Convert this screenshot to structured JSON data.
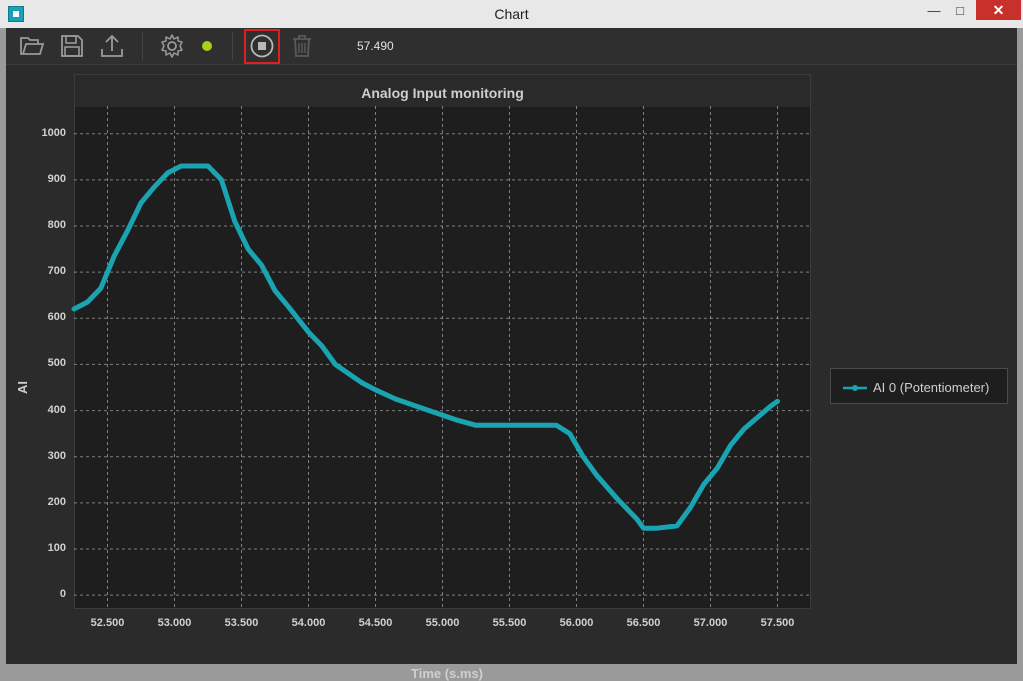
{
  "window": {
    "title": "Chart",
    "minimize_glyph": "—",
    "maximize_glyph": "□",
    "close_glyph": "✕"
  },
  "toolbar": {
    "icons": [
      "folder-open-icon",
      "save-icon",
      "export-icon",
      "gear-icon",
      "status-dot",
      "stop-icon",
      "trash-icon"
    ],
    "time_readout": "57.490",
    "status_color": "#a8d11c"
  },
  "legend": {
    "label": "AI 0 (Potentiometer)"
  },
  "colors": {
    "series": "#1aa3b0",
    "plot_bg": "#1e1e1e",
    "grid": "#cfcfcf",
    "stop_highlight": "#e02020"
  },
  "chart_data": {
    "type": "line",
    "title": "Analog Input monitoring",
    "xlabel": "Time (s.ms)",
    "ylabel": "AI",
    "xlim": [
      52.25,
      57.75
    ],
    "ylim": [
      -30,
      1060
    ],
    "grid": true,
    "legend_position": "right",
    "xticks": [
      52.5,
      53.0,
      53.5,
      54.0,
      54.5,
      55.0,
      55.5,
      56.0,
      56.5,
      57.0,
      57.5
    ],
    "xtick_labels": [
      "52.500",
      "53.000",
      "53.500",
      "54.000",
      "54.500",
      "55.000",
      "55.500",
      "56.000",
      "56.500",
      "57.000",
      "57.500"
    ],
    "yticks": [
      0,
      100,
      200,
      300,
      400,
      500,
      600,
      700,
      800,
      900,
      1000
    ],
    "ytick_labels": [
      "0",
      "100",
      "200",
      "300",
      "400",
      "500",
      "600",
      "700",
      "800",
      "900",
      "1000"
    ],
    "series": [
      {
        "name": "AI 0 (Potentiometer)",
        "x": [
          52.25,
          52.35,
          52.45,
          52.55,
          52.65,
          52.75,
          52.85,
          52.95,
          53.05,
          53.15,
          53.25,
          53.35,
          53.45,
          53.55,
          53.65,
          53.75,
          53.85,
          54.0,
          54.1,
          54.2,
          54.3,
          54.4,
          54.5,
          54.65,
          54.8,
          54.95,
          55.1,
          55.25,
          55.4,
          55.55,
          55.7,
          55.85,
          55.95,
          56.05,
          56.15,
          56.3,
          56.45,
          56.5,
          56.6,
          56.75,
          56.85,
          56.95,
          57.05,
          57.15,
          57.25,
          57.35,
          57.45,
          57.5
        ],
        "y": [
          620,
          635,
          665,
          735,
          790,
          850,
          885,
          915,
          930,
          930,
          930,
          900,
          810,
          750,
          715,
          660,
          625,
          570,
          540,
          500,
          480,
          460,
          445,
          425,
          410,
          395,
          380,
          368,
          368,
          368,
          368,
          368,
          350,
          300,
          260,
          210,
          165,
          145,
          145,
          150,
          190,
          240,
          275,
          325,
          360,
          385,
          410,
          420
        ]
      }
    ]
  }
}
